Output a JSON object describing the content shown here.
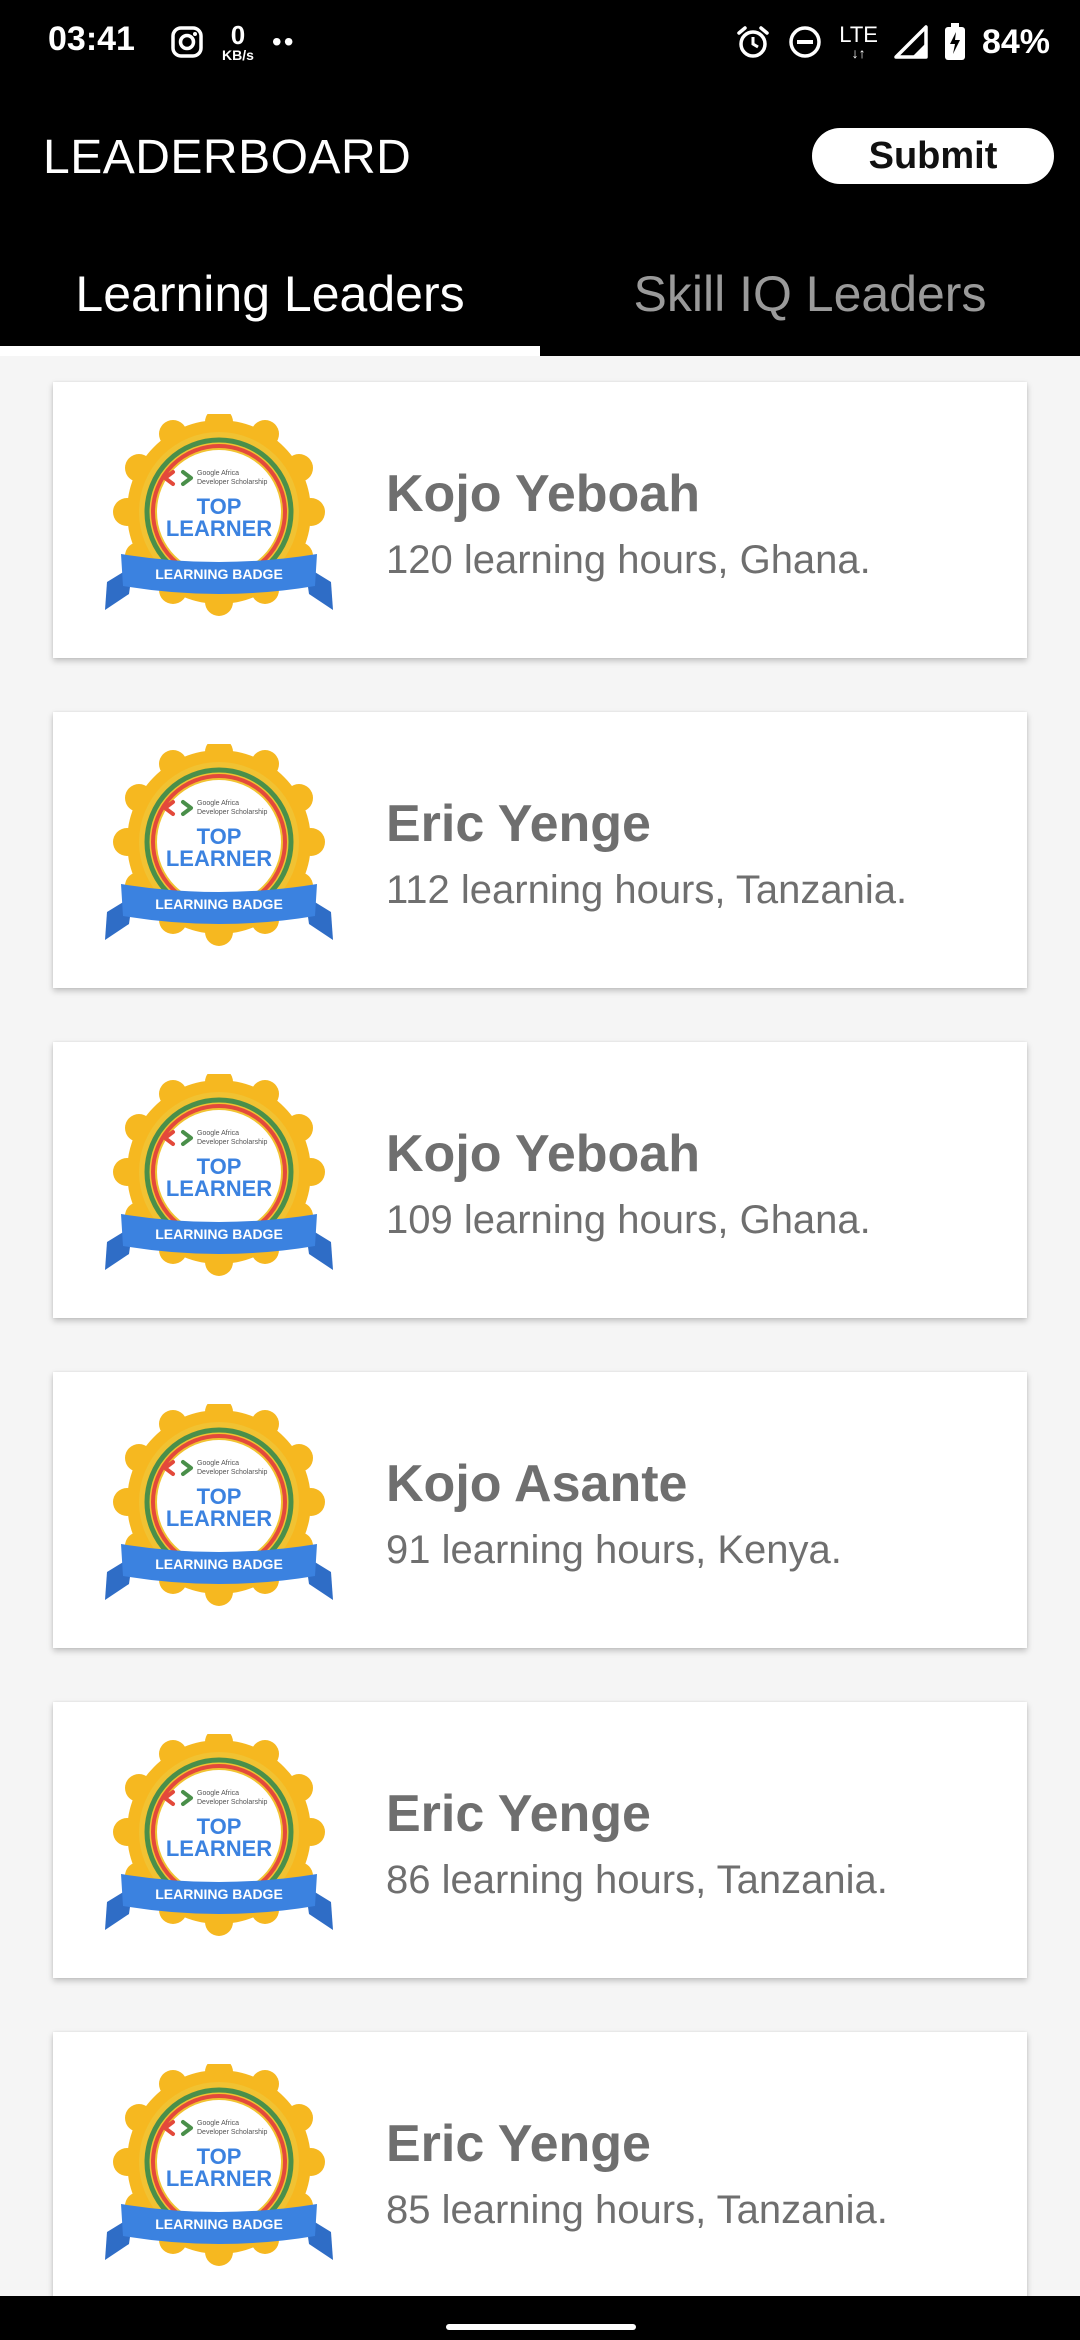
{
  "status_bar": {
    "time": "03:41",
    "net_speed_value": "0",
    "net_speed_unit": "KB/s",
    "dots": "••",
    "lte": "LTE",
    "battery": "84%",
    "icons": [
      "instagram-icon",
      "alarm-icon",
      "dnd-icon",
      "signal-icon",
      "battery-charging-icon"
    ]
  },
  "app_bar": {
    "title": "LEADERBOARD",
    "submit_label": "Submit"
  },
  "tabs": [
    {
      "label": "Learning Leaders",
      "active": true
    },
    {
      "label": "Skill IQ Leaders",
      "active": false
    }
  ],
  "badge": {
    "small_text_1": "Google Africa",
    "small_text_2": "Developer Scholarship",
    "line1": "TOP",
    "line2": "LEARNER",
    "ribbon": "LEARNING BADGE"
  },
  "leaders": [
    {
      "name": "Kojo Yeboah",
      "detail": "120 learning hours, Ghana."
    },
    {
      "name": "Eric Yenge",
      "detail": "112 learning hours, Tanzania."
    },
    {
      "name": "Kojo Yeboah",
      "detail": "109 learning hours, Ghana."
    },
    {
      "name": "Kojo Asante",
      "detail": "91 learning hours, Kenya."
    },
    {
      "name": "Eric Yenge",
      "detail": "86 learning hours, Tanzania."
    },
    {
      "name": "Eric Yenge",
      "detail": "85 learning hours, Tanzania."
    }
  ],
  "colors": {
    "bar_background": "#000000",
    "inactive_tab": "#9a9a9a",
    "card_text": "#6f6f6f",
    "badge_gold": "#f6b820",
    "badge_ribbon": "#3b82e0",
    "badge_ribbon_dark": "#2f6dc6"
  }
}
